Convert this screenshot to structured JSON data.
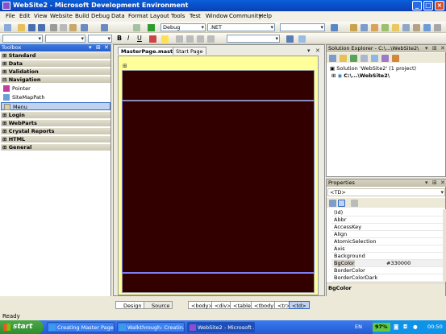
{
  "window": {
    "title": "WebSite2 - Microsoft Development Environment"
  },
  "menu": [
    "File",
    "Edit",
    "View",
    "Website",
    "Build",
    "Debug",
    "Data",
    "Format",
    "Layout",
    "Tools",
    "Test",
    "Window",
    "Community",
    "Help"
  ],
  "toolbar": {
    "config": "Debug",
    "platform": ".NET"
  },
  "toolbox": {
    "title": "Toolbox",
    "categories_top": [
      "Standard",
      "Data",
      "Validation",
      "Navigation"
    ],
    "nav_tools": [
      "Pointer",
      "SiteMapPath",
      "Menu"
    ],
    "categories_bottom": [
      "Login",
      "WebParts",
      "Crystal Reports",
      "HTML",
      "General"
    ]
  },
  "doc": {
    "tabs": [
      "MasterPage.master",
      "Start Page"
    ],
    "view_tabs": [
      "Design",
      "Source"
    ],
    "tag_path": [
      "<body>",
      "<div>",
      "<table>",
      "<tbody>",
      "<tr>",
      "<td>"
    ],
    "selected_bg": "#330000"
  },
  "solution": {
    "title": "Solution Explorer - C:\\...\\WebSite2\\",
    "solution_label": "Solution 'WebSite2' (1 project)",
    "project_label": "C:\\...\\WebSite2\\"
  },
  "properties": {
    "title": "Properties",
    "object": "<TD>",
    "rows": [
      [
        "(Id)",
        ""
      ],
      [
        "Abbr",
        ""
      ],
      [
        "AccessKey",
        ""
      ],
      [
        "Align",
        ""
      ],
      [
        "AtomicSelection",
        ""
      ],
      [
        "Axis",
        ""
      ],
      [
        "Background",
        ""
      ],
      [
        "BgColor",
        "#330000"
      ],
      [
        "BorderColor",
        ""
      ],
      [
        "BorderColorDark",
        ""
      ]
    ],
    "description": "BgColor"
  },
  "status": "Ready",
  "taskbar": {
    "start": "start",
    "tasks": [
      "Creating Master Page...",
      "Walkthrough: Creatin...",
      "WebSite2 - Microsoft ..."
    ],
    "lang": "EN",
    "battery": "97%",
    "clock": "00:50"
  }
}
